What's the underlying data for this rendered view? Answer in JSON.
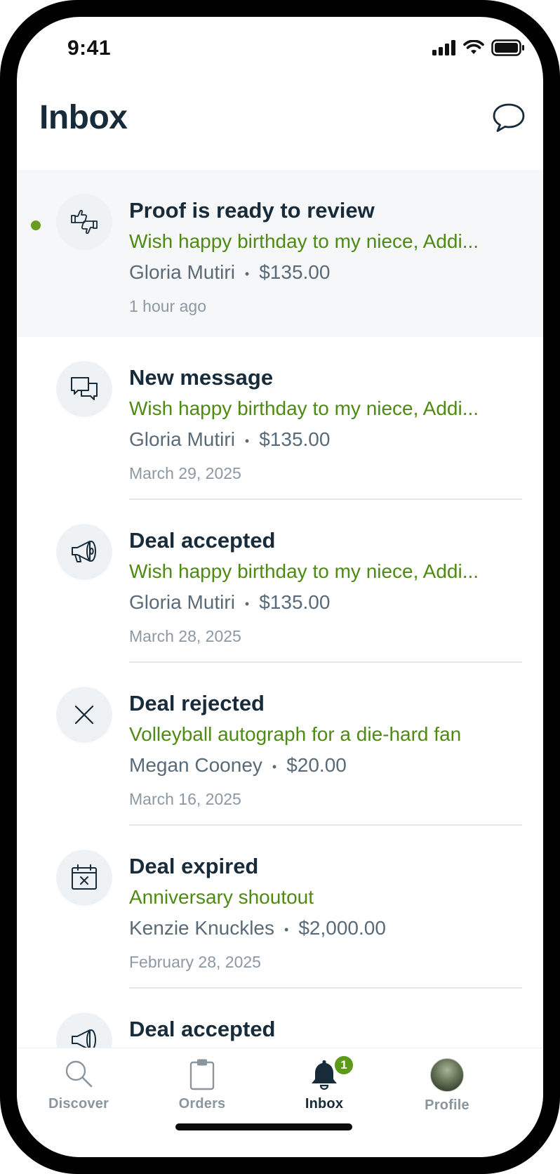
{
  "status_bar": {
    "time": "9:41"
  },
  "header": {
    "title": "Inbox"
  },
  "notifications": [
    {
      "title": "Proof is ready to review",
      "subtitle": "Wish happy birthday to my niece, Addi...",
      "person": "Gloria Mutiri",
      "amount": "$135.00",
      "time": "1 hour ago",
      "icon": "thumbs-up-down-icon",
      "unread": true
    },
    {
      "title": "New message",
      "subtitle": "Wish happy birthday to my niece, Addi...",
      "person": "Gloria Mutiri",
      "amount": "$135.00",
      "time": "March 29, 2025",
      "icon": "chat-bubbles-icon",
      "unread": false
    },
    {
      "title": "Deal accepted",
      "subtitle": "Wish happy birthday to my niece, Addi...",
      "person": "Gloria Mutiri",
      "amount": "$135.00",
      "time": "March 28, 2025",
      "icon": "megaphone-icon",
      "unread": false
    },
    {
      "title": "Deal rejected",
      "subtitle": "Volleyball autograph for a die-hard fan",
      "person": "Megan Cooney",
      "amount": "$20.00",
      "time": "March 16, 2025",
      "icon": "x-icon",
      "unread": false
    },
    {
      "title": "Deal expired",
      "subtitle": "Anniversary shoutout",
      "person": "Kenzie Knuckles",
      "amount": "$2,000.00",
      "time": "February 28, 2025",
      "icon": "calendar-x-icon",
      "unread": false
    },
    {
      "title": "Deal accepted",
      "icon": "megaphone-icon",
      "unread": false
    }
  ],
  "tab_bar": {
    "tabs": [
      {
        "label": "Discover",
        "icon": "search-icon",
        "active": false
      },
      {
        "label": "Orders",
        "icon": "clipboard-icon",
        "active": false
      },
      {
        "label": "Inbox",
        "icon": "bell-icon",
        "active": true,
        "badge": "1"
      },
      {
        "label": "Profile",
        "icon": "avatar",
        "active": false
      }
    ]
  },
  "colors": {
    "accent_green": "#4E8A14",
    "unread_dot": "#6A9D1F",
    "title": "#172B3A",
    "unread_background": "#F5F7F9"
  }
}
